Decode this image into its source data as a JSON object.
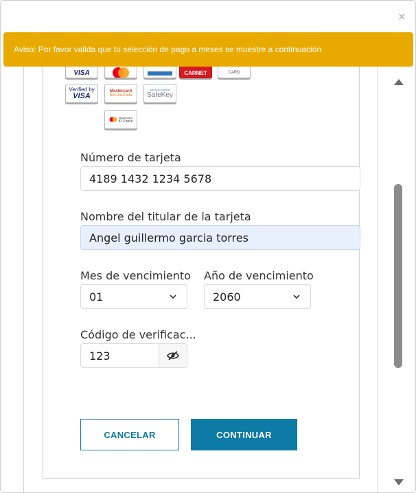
{
  "alert": {
    "text": "Aviso: Por favor valida que tu selección de pago a meses se muestre a continuación"
  },
  "close_label": "×",
  "cards": {
    "visa": "VISA",
    "carnet": "CARNET",
    "card": "CARD",
    "verified_by": "Verified by",
    "verified_visa": "VISA",
    "mc_secure_1": "Mastercard",
    "mc_secure_2": "SecureCode",
    "amex_small": "AMERICAN EXPRESS",
    "safekey": "SafeKey",
    "idcheck_1": "mastercard",
    "idcheck_2": "ID Check"
  },
  "form": {
    "card_number_label": "Número de tarjeta",
    "card_number_value": "4189 1432 1234 5678",
    "holder_label": "Nombre del titular de la tarjeta",
    "holder_value": "Angel guillermo garcia torres",
    "month_label": "Mes de vencimiento",
    "month_value": "01",
    "year_label": "Año de vencimiento",
    "year_value": "2060",
    "cvv_label": "Código de verificac...",
    "cvv_value": "123"
  },
  "buttons": {
    "cancel": "CANCELAR",
    "continue": "CONTINUAR"
  },
  "colors": {
    "alert": "#e9aa00",
    "primary": "#0e7aa6",
    "autofill": "#e8f0fe"
  }
}
